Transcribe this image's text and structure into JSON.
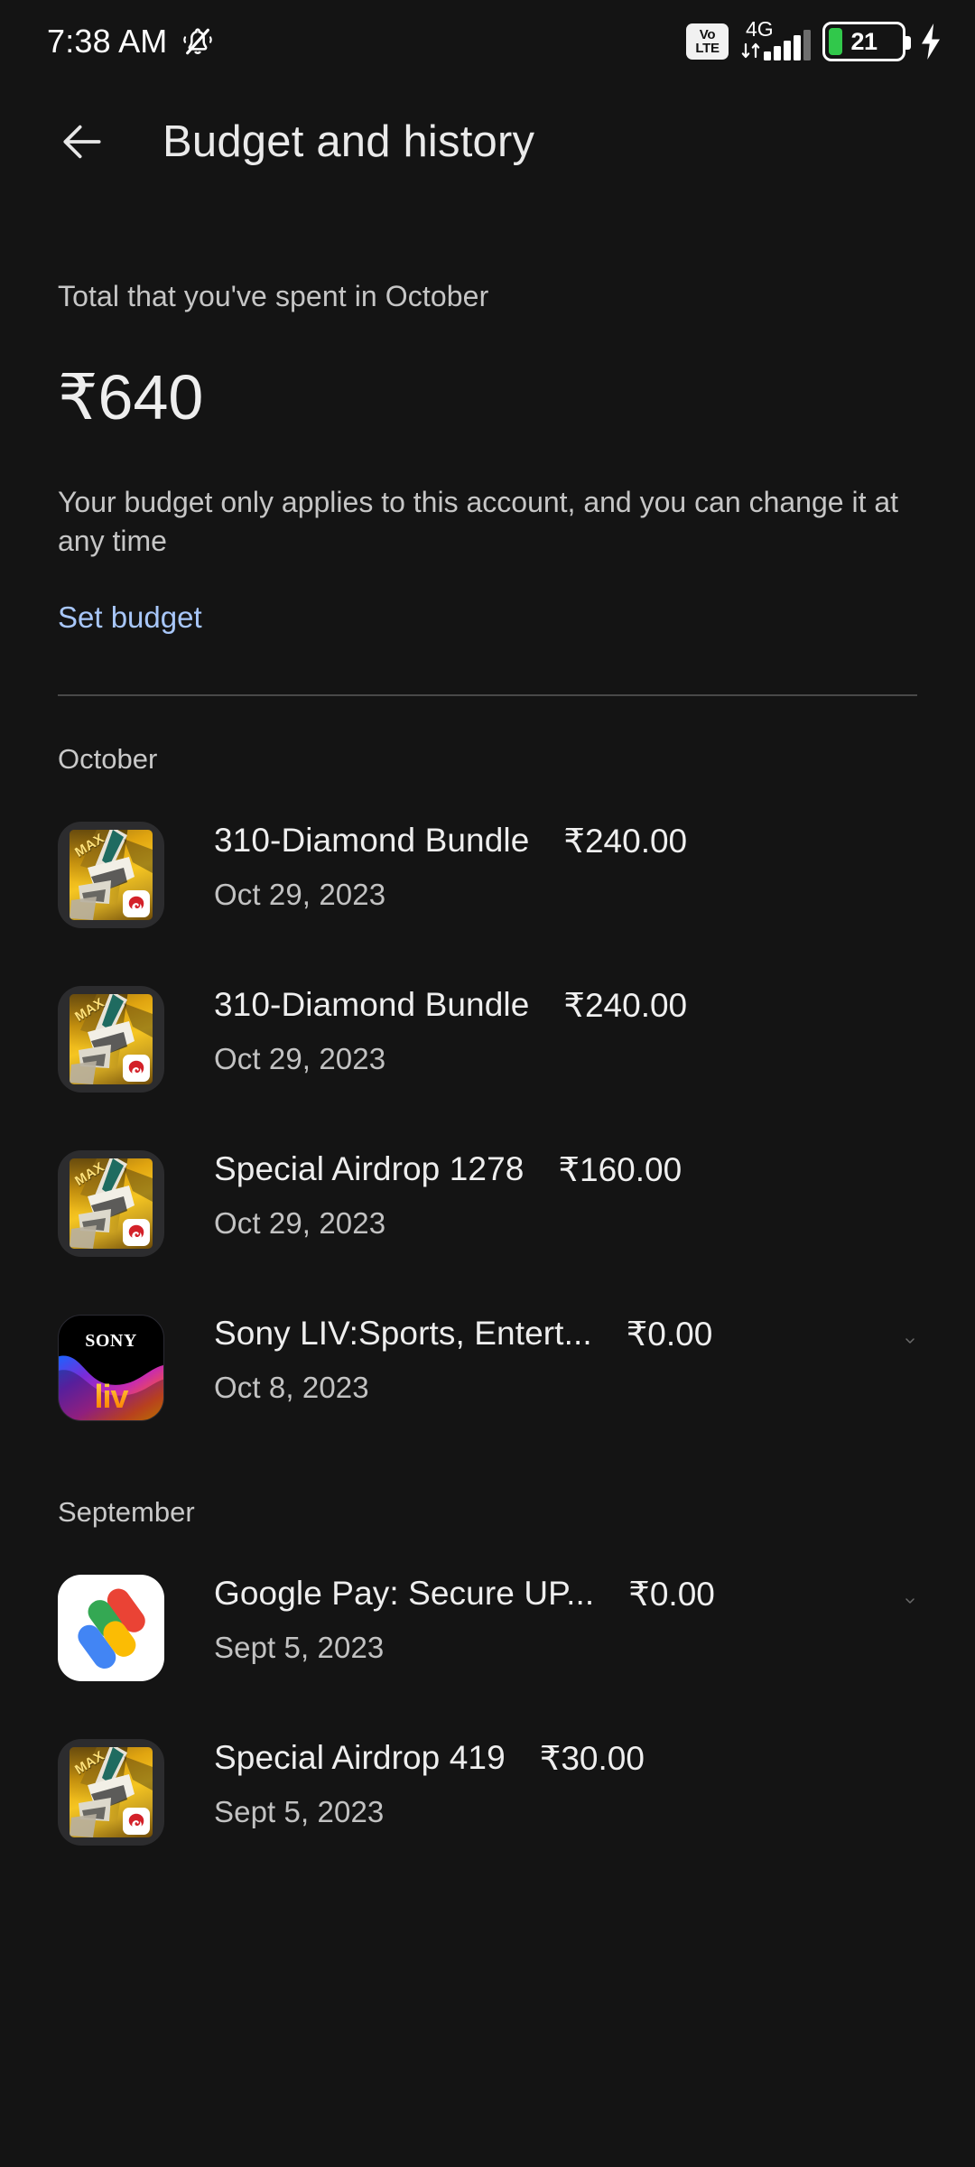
{
  "status_bar": {
    "time": "7:38 AM",
    "mute_icon": "bell-mute-icon",
    "volte_top": "Vo",
    "volte_bottom": "LTE",
    "network_type": "4G",
    "battery_level": "21",
    "battery_color": "#31c84b",
    "charging_icon": "lightning-bolt-icon"
  },
  "app_bar": {
    "back_icon": "back-arrow-icon",
    "title": "Budget and history"
  },
  "budget": {
    "spent_label": "Total that you've spent in October",
    "spent_amount": "₹640",
    "note": "Your budget only applies to this account, and you can change it at any time",
    "set_budget_label": "Set budget",
    "set_budget_color": "#a8c7fa"
  },
  "sections": [
    {
      "label": "October",
      "rows": [
        {
          "icon": "free-fire-max-app-icon",
          "icon_badge": "garena-logo",
          "title": "310-Diamond Bundle",
          "price": "₹240.00",
          "date": "Oct 29, 2023",
          "expandable": false
        },
        {
          "icon": "free-fire-max-app-icon",
          "icon_badge": "garena-logo",
          "title": "310-Diamond Bundle",
          "price": "₹240.00",
          "date": "Oct 29, 2023",
          "expandable": false
        },
        {
          "icon": "free-fire-max-app-icon",
          "icon_badge": "garena-logo",
          "title": "Special Airdrop 1278",
          "price": "₹160.00",
          "date": "Oct 29, 2023",
          "expandable": false
        },
        {
          "icon": "sony-liv-app-icon",
          "icon_badge": "",
          "title": "Sony LIV:Sports, Entert...",
          "price": "₹0.00",
          "date": "Oct 8, 2023",
          "expandable": true
        }
      ]
    },
    {
      "label": "September",
      "rows": [
        {
          "icon": "google-pay-app-icon",
          "icon_badge": "",
          "title": "Google Pay: Secure UP...",
          "price": "₹0.00",
          "date": "Sept 5, 2023",
          "expandable": true
        },
        {
          "icon": "free-fire-max-app-icon",
          "icon_badge": "garena-logo",
          "title": "Special Airdrop 419",
          "price": "₹30.00",
          "date": "Sept 5, 2023",
          "expandable": false
        }
      ]
    }
  ],
  "icons": {
    "chevron_down": "chevron-down-icon",
    "max_label": "MAX",
    "sony_label": "SONY",
    "liv_label": "liv"
  }
}
